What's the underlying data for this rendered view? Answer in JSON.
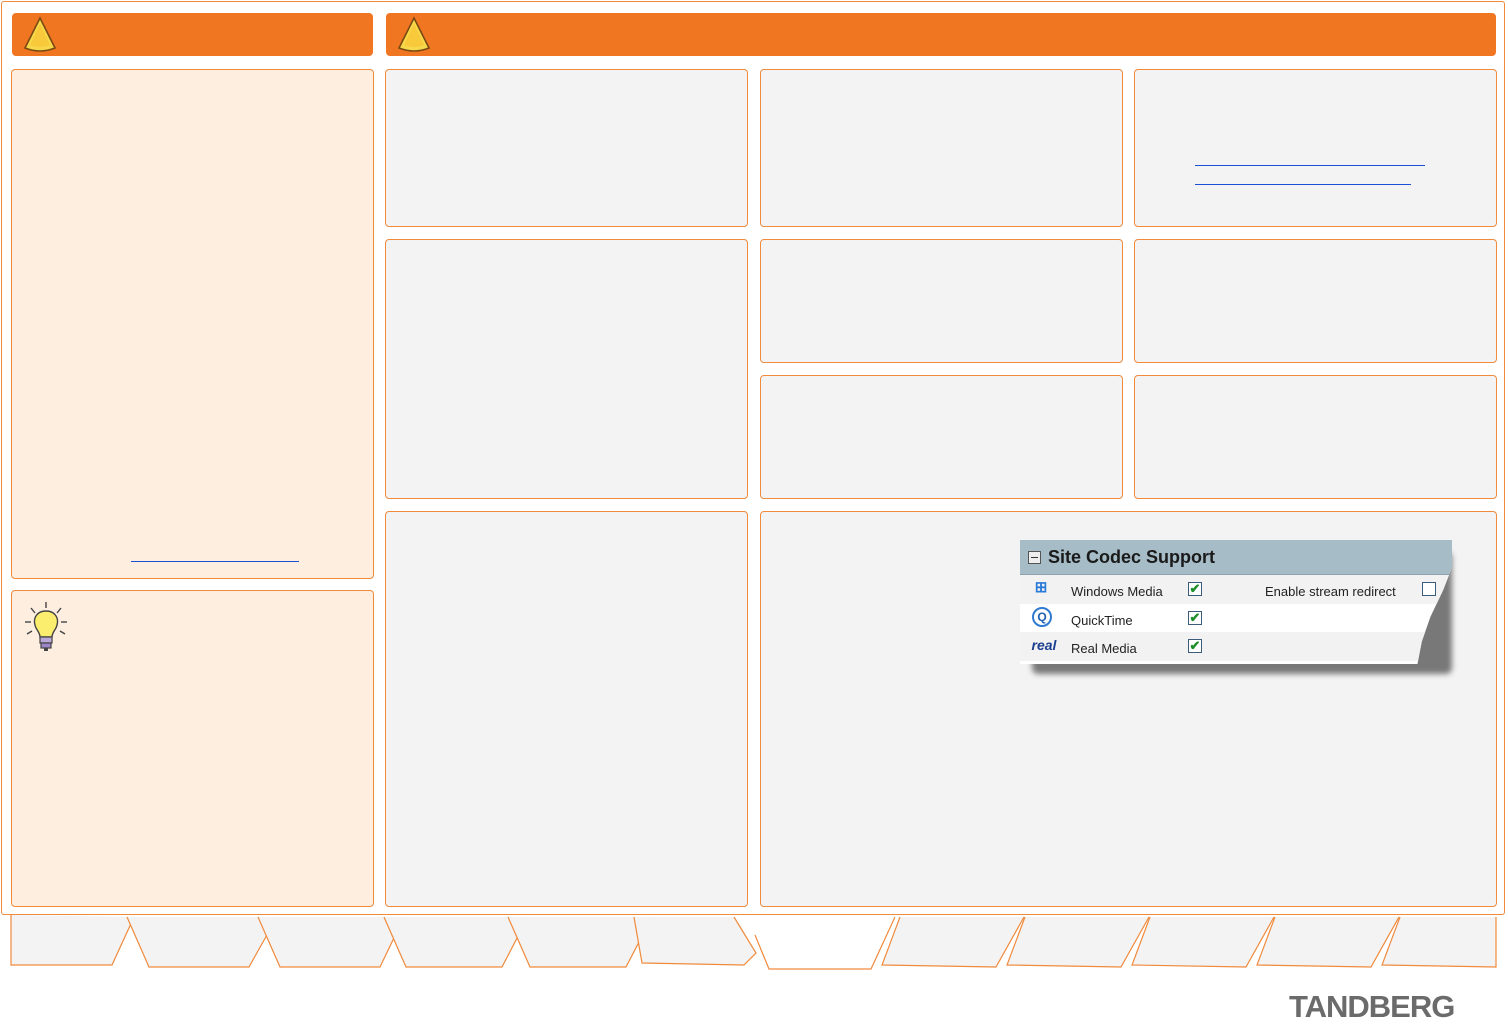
{
  "colors": {
    "accent": "#f07622",
    "panel_bg": "#f3f3f3",
    "cream_bg": "#fdeedf",
    "link": "#1a4fd6"
  },
  "header_left": {
    "icon": "warning-cone-icon"
  },
  "header_right": {
    "icon": "warning-cone-icon"
  },
  "tip": {
    "icon": "lightbulb-icon"
  },
  "codec_widget": {
    "title": "Site Codec Support",
    "rows": [
      {
        "icon": "windows-media-icon",
        "label": "Windows Media",
        "checked": true
      },
      {
        "icon": "quicktime-icon",
        "label": "QuickTime",
        "checked": true
      },
      {
        "icon": "real-media-icon",
        "label": "Real Media",
        "checked": true
      }
    ],
    "redirect_label": "Enable stream redirect",
    "redirect_checked": false,
    "check_glyph": "✔",
    "icon_glyphs": {
      "windows": "⊞",
      "quicktime": "Q",
      "real": "real"
    }
  },
  "brand": {
    "logo": "TANDBERG"
  }
}
